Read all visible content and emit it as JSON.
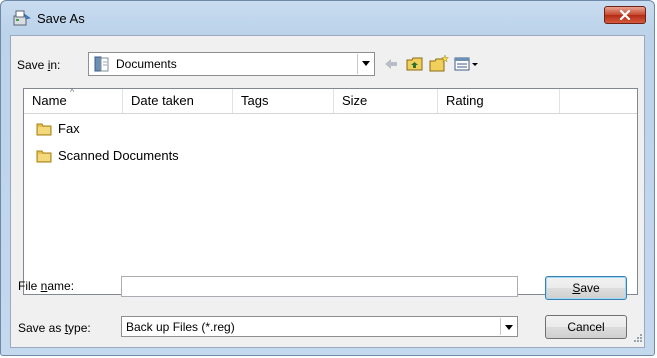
{
  "window": {
    "title": "Save As"
  },
  "toolbar": {
    "save_in_prefix": "Save ",
    "save_in_accel": "i",
    "save_in_suffix": "n:",
    "location": "Documents",
    "back_icon": "back-arrow-icon",
    "up_icon": "up-one-level-icon",
    "new_folder_icon": "new-folder-icon",
    "views_icon": "views-menu-icon"
  },
  "list": {
    "columns": [
      "Name",
      "Date taken",
      "Tags",
      "Size",
      "Rating"
    ],
    "sort_indicator": "^",
    "items": [
      {
        "name": "Fax",
        "icon": "folder-icon"
      },
      {
        "name": "Scanned Documents",
        "icon": "folder-icon"
      }
    ]
  },
  "file_name": {
    "label_prefix": "File ",
    "label_accel": "n",
    "label_suffix": "ame:",
    "value": ""
  },
  "save_type": {
    "label_prefix": "Save as ",
    "label_accel": "t",
    "label_suffix": "ype:",
    "value": "Back up Files (*.reg)"
  },
  "buttons": {
    "save_accel": "S",
    "save_rest": "ave",
    "cancel": "Cancel"
  },
  "colors": {
    "title_bg": "#bcd3ea",
    "close_red": "#c5462d",
    "folder_yellow": "#e8c04a"
  }
}
